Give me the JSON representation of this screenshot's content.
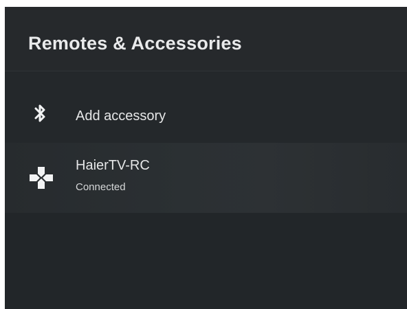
{
  "header": {
    "title": "Remotes & Accessories"
  },
  "menu": {
    "items": [
      {
        "label": "Add accessory",
        "icon": "bluetooth-icon"
      },
      {
        "label": "HaierTV-RC",
        "status": "Connected",
        "icon": "gamepad-icon"
      }
    ]
  },
  "colors": {
    "background": "#24282b",
    "text": "#e6e7e8",
    "selected_row": "#2d3134"
  }
}
